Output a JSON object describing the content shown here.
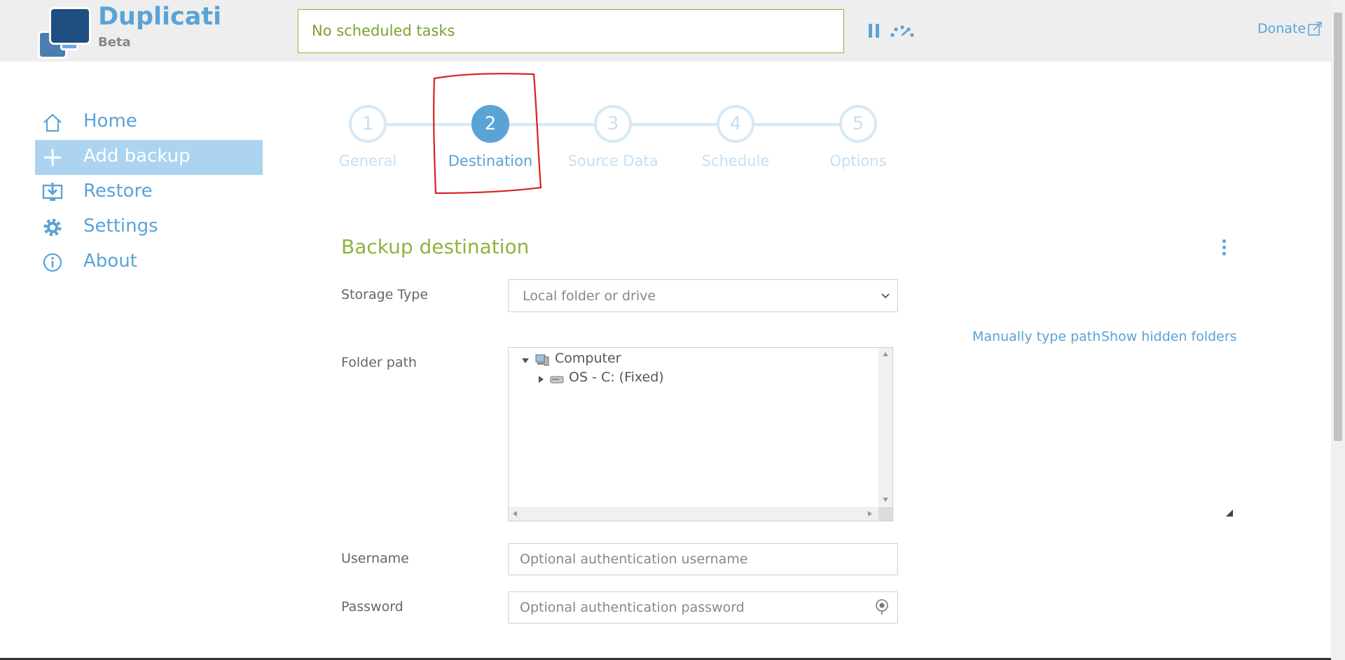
{
  "header": {
    "brand": "Duplicati",
    "brand_sub": "Beta",
    "status_text": "No scheduled tasks",
    "donate_label": "Donate"
  },
  "sidebar": {
    "items": [
      {
        "label": "Home",
        "icon": "home-icon",
        "active": false
      },
      {
        "label": "Add backup",
        "icon": "plus-icon",
        "active": true
      },
      {
        "label": "Restore",
        "icon": "restore-icon",
        "active": false
      },
      {
        "label": "Settings",
        "icon": "gear-icon",
        "active": false
      },
      {
        "label": "About",
        "icon": "info-icon",
        "active": false
      }
    ]
  },
  "wizard": {
    "active_step": 2,
    "steps": [
      {
        "number": "1",
        "label": "General"
      },
      {
        "number": "2",
        "label": "Destination"
      },
      {
        "number": "3",
        "label": "Source Data"
      },
      {
        "number": "4",
        "label": "Schedule"
      },
      {
        "number": "5",
        "label": "Options"
      }
    ]
  },
  "form": {
    "title": "Backup destination",
    "storage_type": {
      "label": "Storage Type",
      "value": "Local folder or drive"
    },
    "folder_path": {
      "label": "Folder path",
      "manual_link": "Manually type path",
      "hidden_link": "Show hidden folders",
      "tree": [
        {
          "label": "Computer",
          "expanded": true,
          "icon": "computer-icon"
        },
        {
          "label": "OS - C: (Fixed)",
          "expanded": false,
          "icon": "drive-icon"
        }
      ]
    },
    "username": {
      "label": "Username",
      "placeholder": "Optional authentication username",
      "value": ""
    },
    "password": {
      "label": "Password",
      "placeholder": "Optional authentication password",
      "value": ""
    }
  },
  "colors": {
    "accent": "#5aa3d6",
    "active_nav_bg": "#acd3ef",
    "section_title": "#8db53c",
    "annotation": "#d62020"
  }
}
